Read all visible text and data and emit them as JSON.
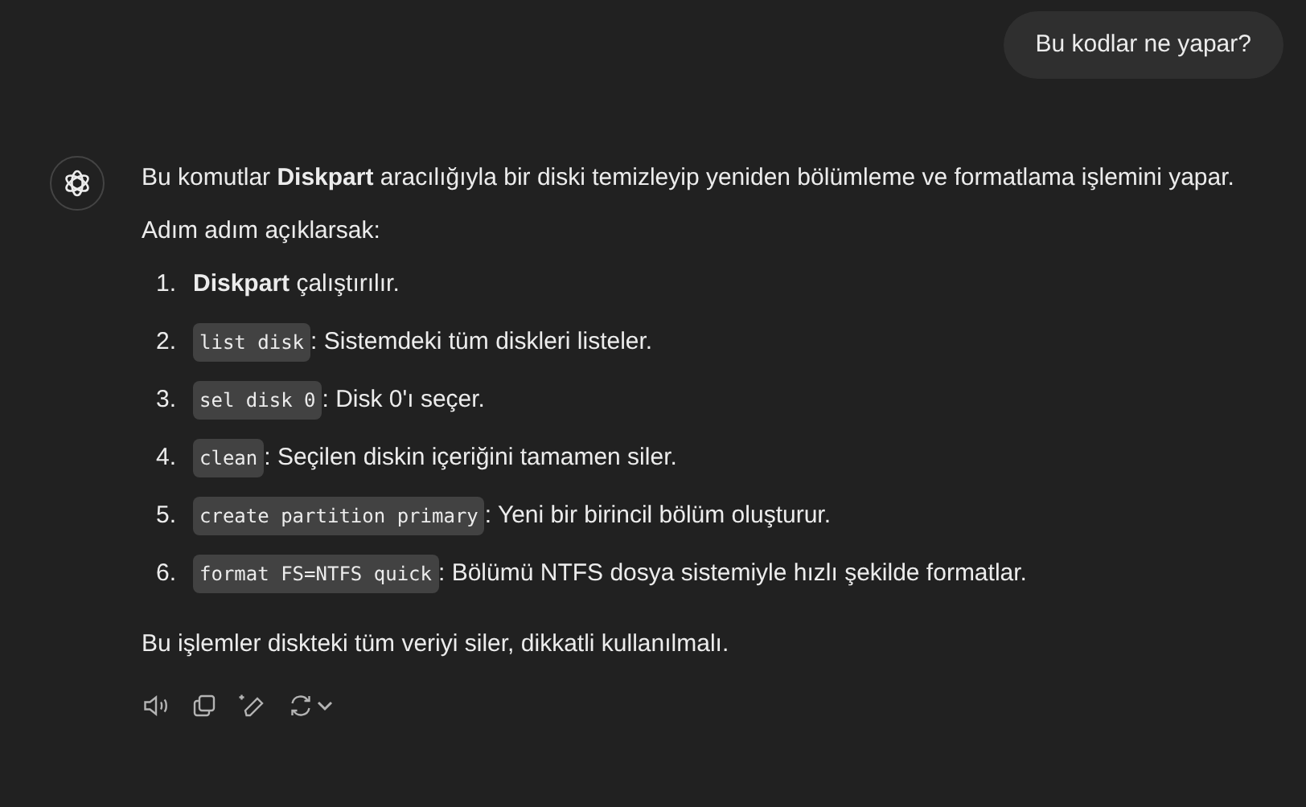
{
  "user_message": {
    "text": "Bu kodlar ne yapar?"
  },
  "assistant_message": {
    "intro": "Bu komutlar **Diskpart** aracılığıyla bir diski temizleyip yeniden bölümleme ve formatlama işlemini yapar. Adım adım açıklarsak:",
    "steps": [
      {
        "number": "1.",
        "text": "**Diskpart** çalıştırılır."
      },
      {
        "number": "2.",
        "code": "list disk",
        "text": ": Sistemdeki tüm diskleri listeler."
      },
      {
        "number": "3.",
        "code": "sel disk 0",
        "text": ": Disk 0'ı seçer."
      },
      {
        "number": "4.",
        "code": "clean",
        "text": ": Seçilen diskin içeriğini tamamen siler."
      },
      {
        "number": "5.",
        "code": "create partition primary",
        "text": ": Yeni bir birincil bölüm oluşturur."
      },
      {
        "number": "6.",
        "code": "format FS=NTFS quick",
        "text": ": Bölümü NTFS dosya sistemiyle hızlı şekilde formatlar."
      }
    ],
    "closing": "Bu işlemler diskteki tüm veriyi siler, dikkatli kullanılmalı."
  }
}
